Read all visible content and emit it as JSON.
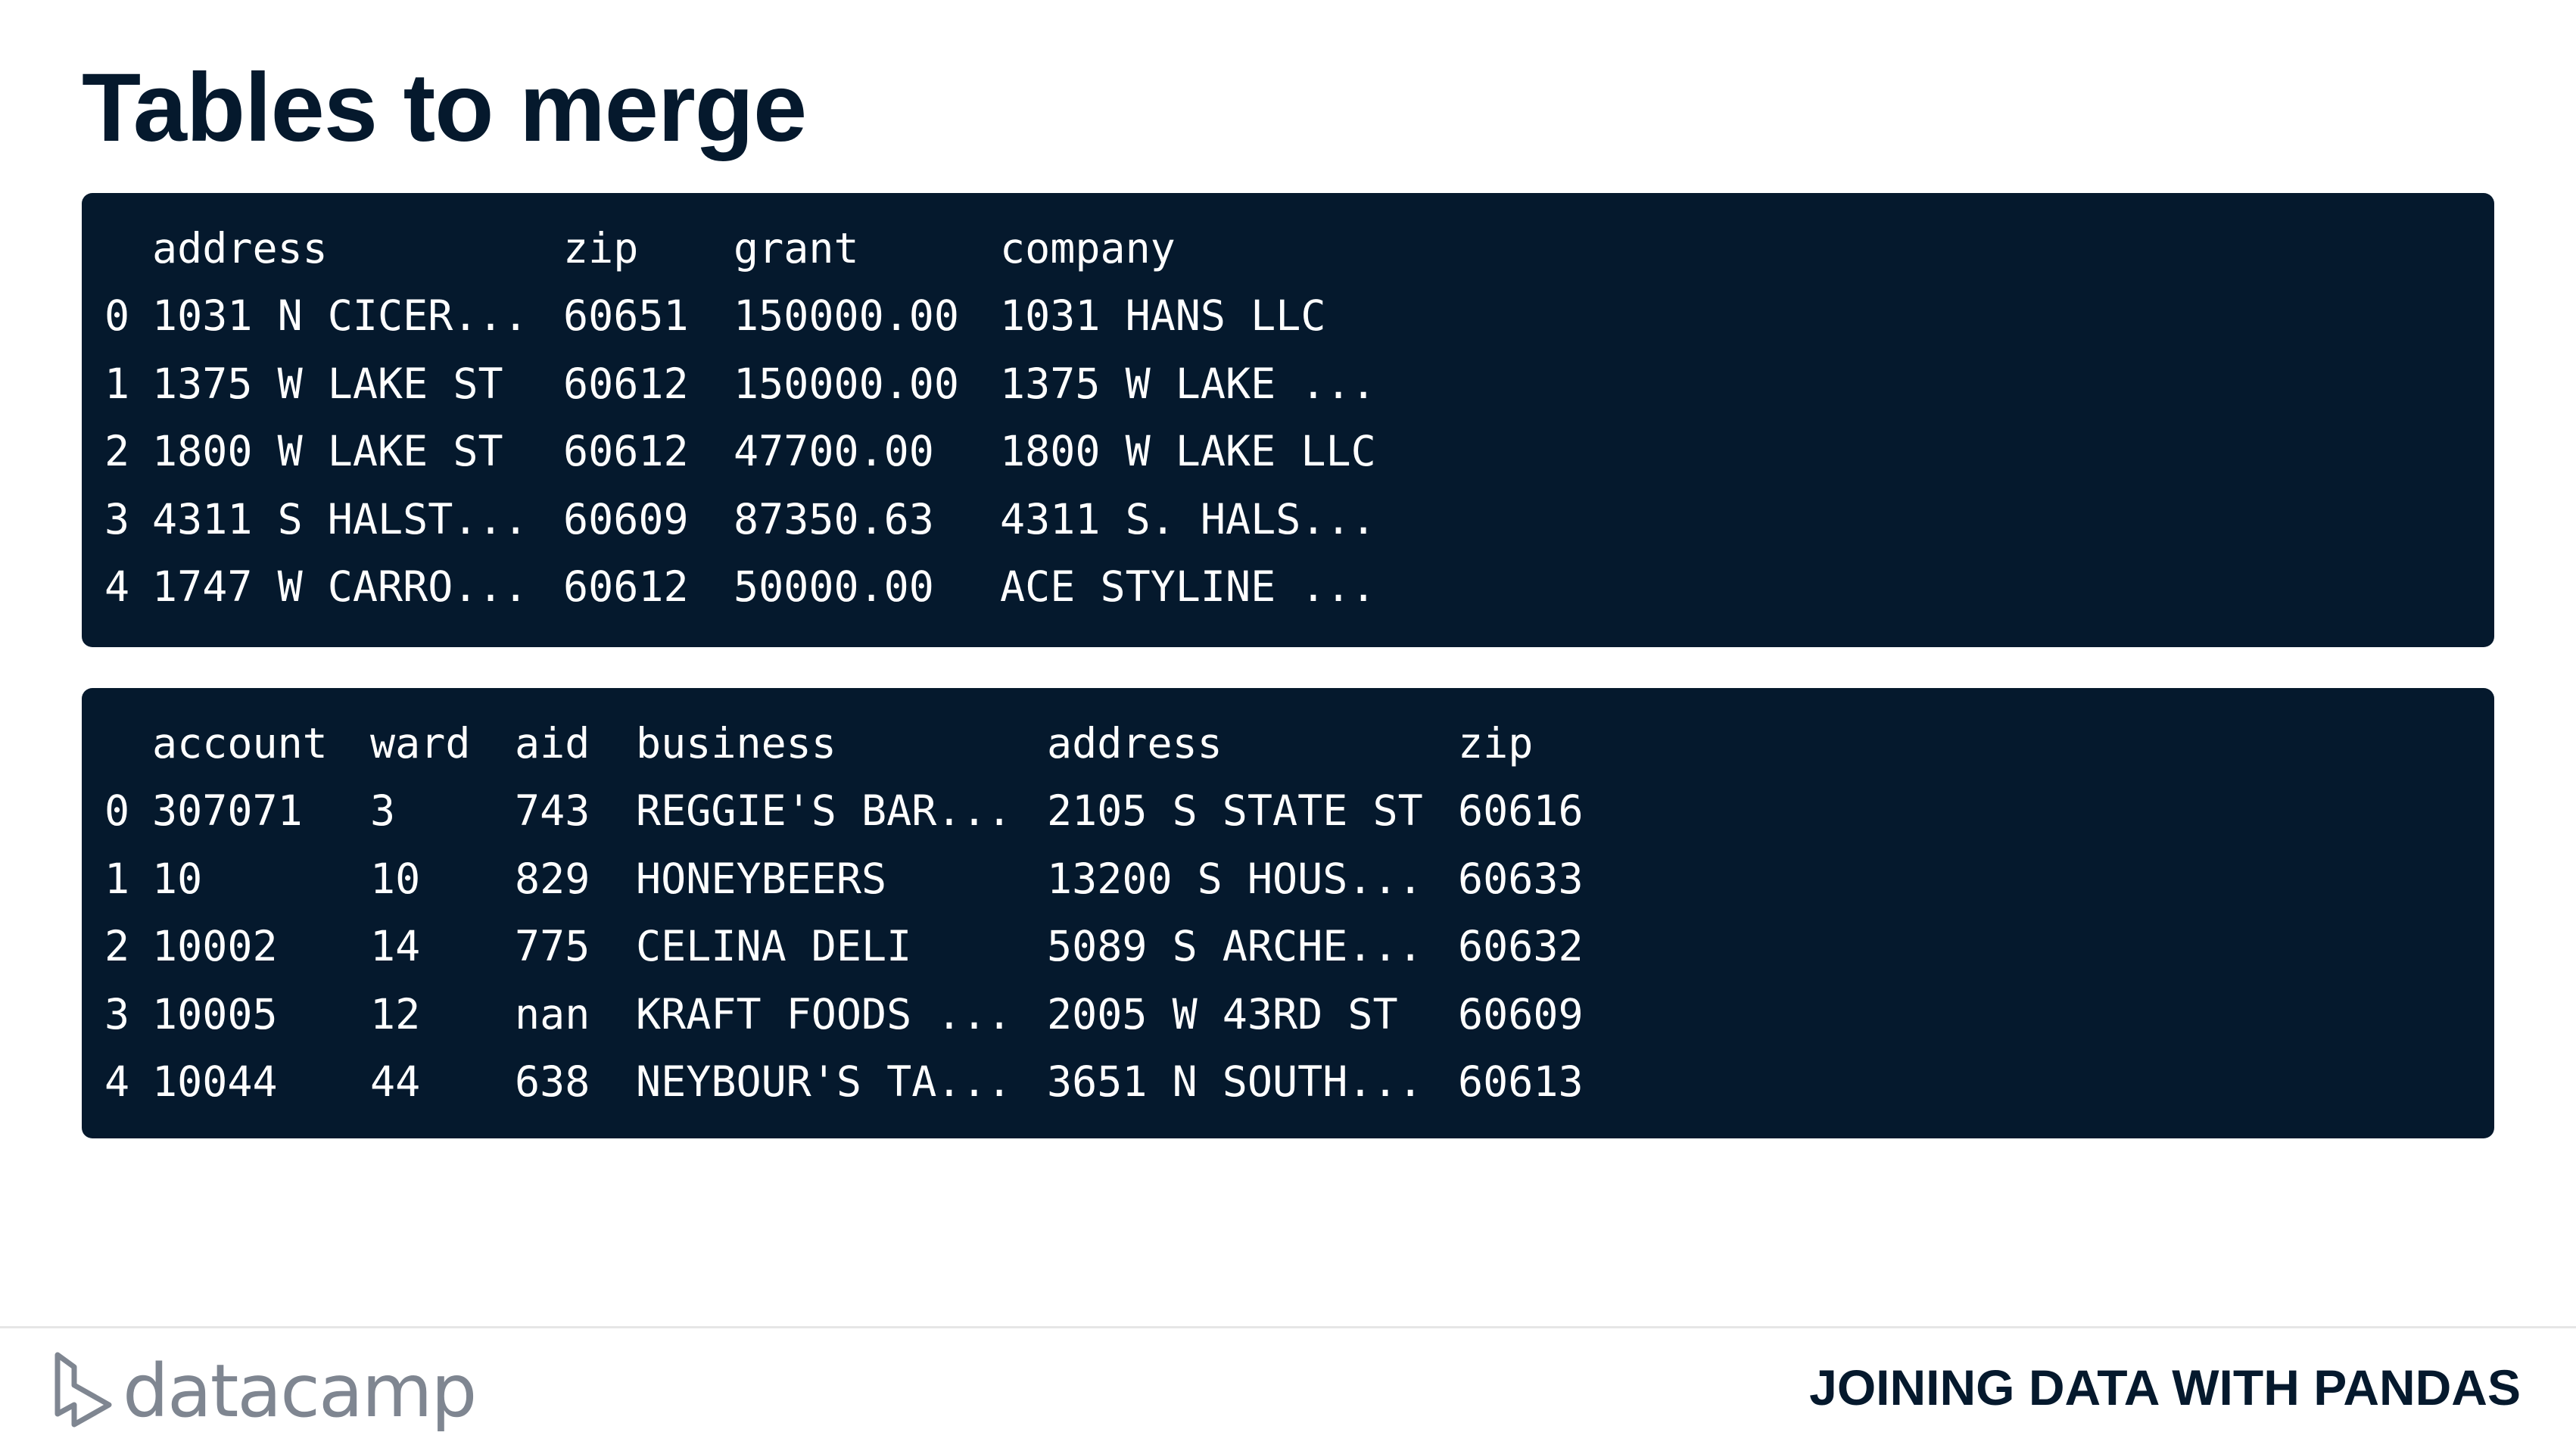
{
  "slide": {
    "title": "Tables to merge"
  },
  "table1": {
    "columns": [
      "address",
      "zip",
      "grant",
      "company"
    ],
    "rows": [
      {
        "index": "0",
        "cells": [
          "1031 N CICER...",
          "60651",
          "150000.00",
          "1031 HANS LLC"
        ]
      },
      {
        "index": "1",
        "cells": [
          "1375 W LAKE ST",
          "60612",
          "150000.00",
          "1375 W LAKE ..."
        ]
      },
      {
        "index": "2",
        "cells": [
          "1800 W LAKE ST",
          "60612",
          "47700.00",
          "1800 W LAKE LLC"
        ]
      },
      {
        "index": "3",
        "cells": [
          "4311 S HALST...",
          "60609",
          "87350.63",
          "4311 S. HALS..."
        ]
      },
      {
        "index": "4",
        "cells": [
          "1747 W CARRO...",
          "60612",
          "50000.00",
          "ACE STYLINE ..."
        ]
      }
    ]
  },
  "table2": {
    "columns": [
      "account",
      "ward",
      "aid",
      "business",
      "address",
      "zip"
    ],
    "rows": [
      {
        "index": "0",
        "cells": [
          "307071",
          "3",
          "743",
          "REGGIE'S BAR...",
          "2105 S STATE ST",
          "60616"
        ]
      },
      {
        "index": "1",
        "cells": [
          "10",
          "10",
          "829",
          "HONEYBEERS",
          "13200 S HOUS...",
          "60633"
        ]
      },
      {
        "index": "2",
        "cells": [
          "10002",
          "14",
          "775",
          "CELINA DELI",
          "5089 S ARCHE...",
          "60632"
        ]
      },
      {
        "index": "3",
        "cells": [
          "10005",
          "12",
          "nan",
          "KRAFT FOODS ...",
          "2005 W 43RD ST",
          "60609"
        ]
      },
      {
        "index": "4",
        "cells": [
          "10044",
          "44",
          "638",
          "NEYBOUR'S TA...",
          "3651 N SOUTH...",
          "60613"
        ]
      }
    ]
  },
  "footer": {
    "logo_text": "datacamp",
    "logo_icon": "datacamp-logo-icon",
    "course_title": "JOINING DATA WITH PANDAS"
  },
  "colors": {
    "code_background": "#05192d",
    "title_text": "#05192d",
    "logo_gray": "#7f8691"
  }
}
